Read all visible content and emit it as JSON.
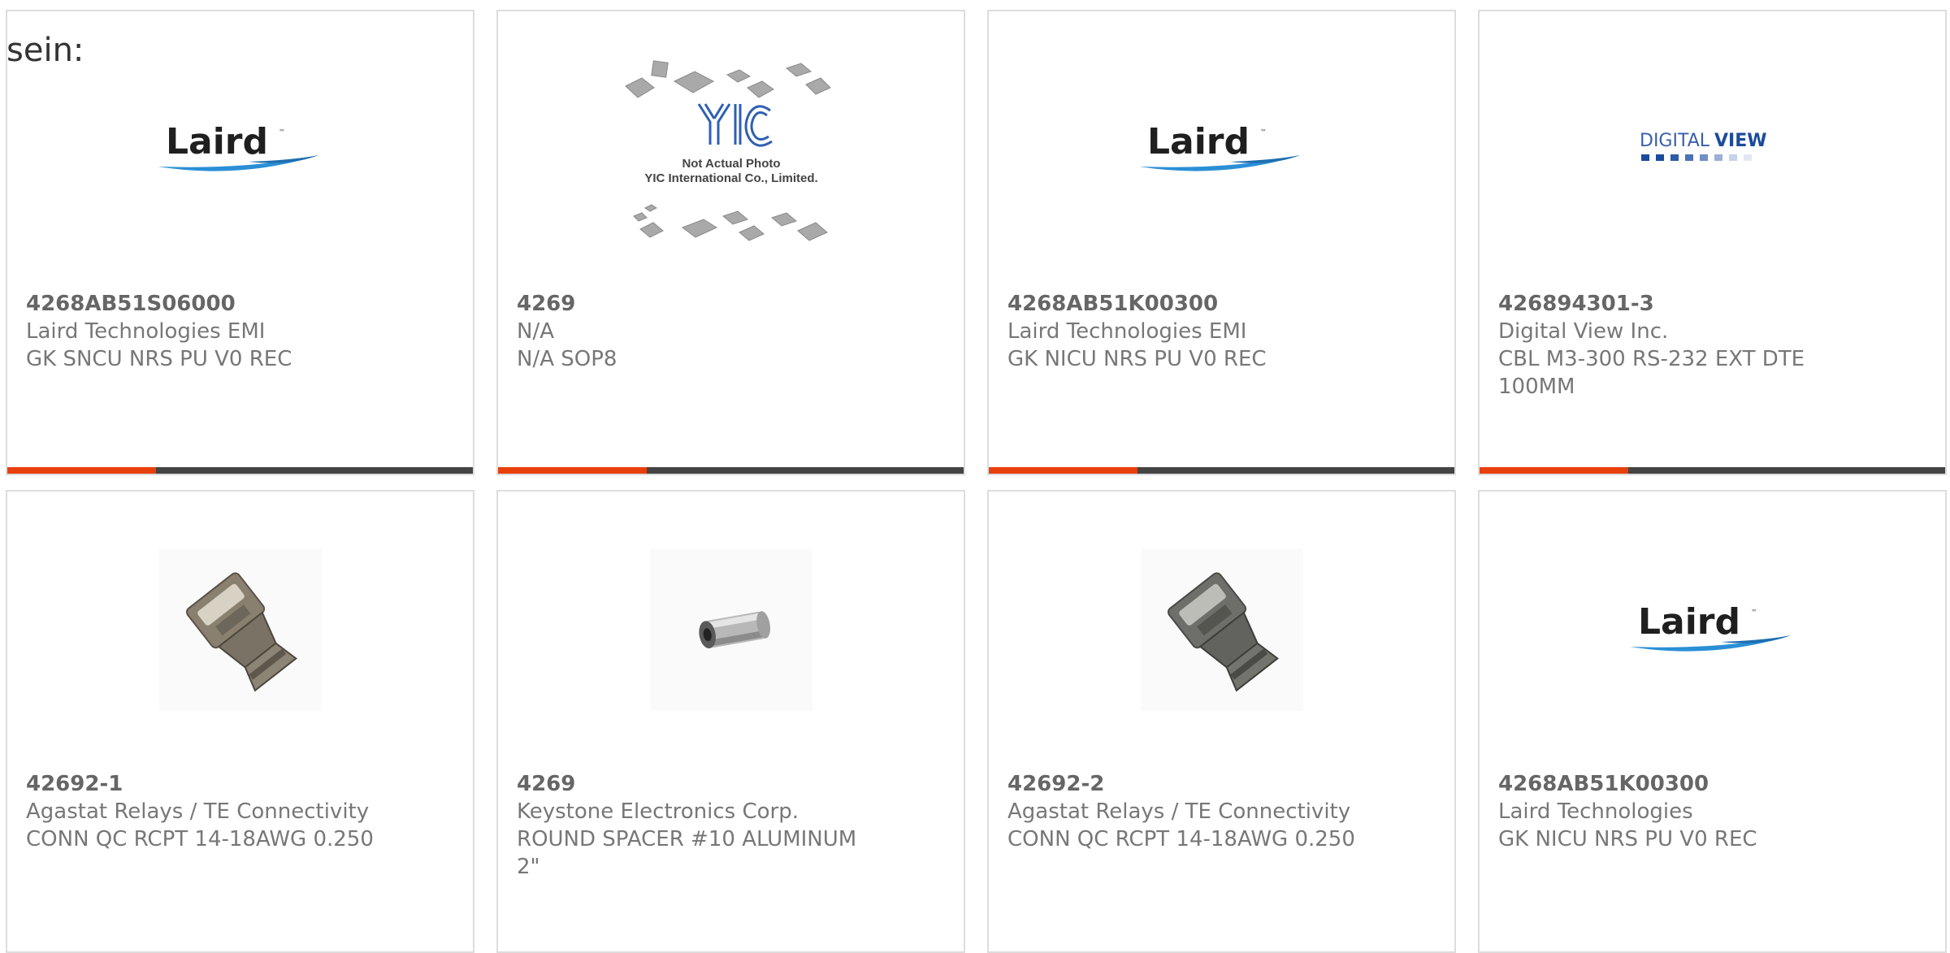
{
  "heading": "sein:",
  "colors": {
    "accent_bar": "#e8400c",
    "dark_bar": "#444444",
    "laird_swoosh": "#2a8fd6",
    "digitalview_blue": "#1a4b9c"
  },
  "products": [
    {
      "part": "4268AB51S06000",
      "manufacturer": "Laird Technologies EMI",
      "description": "GK SNCU NRS PU V0 REC",
      "image": "laird-logo",
      "logo_text": "Laird"
    },
    {
      "part": "4269",
      "manufacturer": "N/A",
      "description": "N/A SOP8",
      "image": "yic-placeholder",
      "logo_text": "YIC",
      "caption_line1": "Not Actual Photo",
      "caption_line2": "YIC International Co., Limited."
    },
    {
      "part": "4268AB51K00300",
      "manufacturer": "Laird Technologies EMI",
      "description": "GK NICU NRS PU V0 REC",
      "image": "laird-logo",
      "logo_text": "Laird"
    },
    {
      "part": "426894301-3",
      "manufacturer": "Digital View Inc.",
      "description": "CBL M3-300 RS-232 EXT DTE 100MM",
      "image": "digitalview-logo",
      "logo_text_a": "DIGITAL",
      "logo_text_b": "VIEW"
    },
    {
      "part": "42692-1",
      "manufacturer": "Agastat Relays / TE Connectivity",
      "description": "CONN QC RCPT 14-18AWG 0.250",
      "image": "qc-receptacle-photo"
    },
    {
      "part": "4269",
      "manufacturer": "Keystone Electronics Corp.",
      "description": "ROUND SPACER #10 ALUMINUM 2\"",
      "image": "round-spacer-photo"
    },
    {
      "part": "42692-2",
      "manufacturer": "Agastat Relays / TE Connectivity",
      "description": "CONN QC RCPT 14-18AWG 0.250",
      "image": "qc-receptacle-photo"
    },
    {
      "part": "4268AB51K00300",
      "manufacturer": "Laird Technologies",
      "description": "GK NICU NRS PU V0 REC",
      "image": "laird-logo",
      "logo_text": "Laird"
    }
  ]
}
